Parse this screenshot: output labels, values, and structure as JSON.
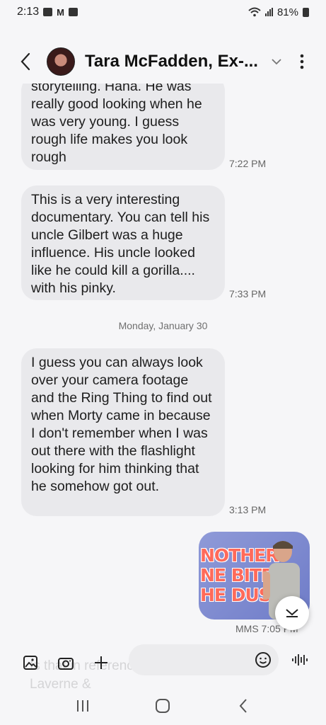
{
  "status_bar": {
    "time": "2:13",
    "battery_percent": "81%"
  },
  "header": {
    "contact_name": "Tara McFadden, Ex-..."
  },
  "messages": [
    {
      "text": "storytelling. Haha. He was really good looking when he was very young. I guess rough life makes you look rough",
      "time": "7:22 PM"
    },
    {
      "text": "This is a very interesting documentary. You can tell his uncle Gilbert was a huge influence. His uncle looked like he could kill a gorilla.... with his pinky.",
      "time": "7:33 PM"
    },
    {
      "text": "I guess you can always look over your camera footage and the Ring Thing to find out when Morty came in because I don't remember when I was out there with the flashlight looking for him thinking that he somehow got out.",
      "time": "3:13 PM"
    }
  ],
  "date_separator": "Monday, January 30",
  "mms": {
    "image_text_line1": "NOTHER",
    "image_text_line2": "NE BITES",
    "image_text_line3": "HE DUST",
    "time": "MMS 7:05 PM"
  },
  "composer": {
    "placeholder": "",
    "ghost_text": "Is that in reference to Shirley from Laverne &"
  },
  "icons": [
    "back-icon",
    "chevron-down-icon",
    "more-vert-icon",
    "gallery-icon",
    "camera-icon",
    "plus-icon",
    "emoji-icon",
    "voice-icon",
    "chevron-down-icon",
    "recents-icon",
    "home-icon",
    "back-nav-icon"
  ]
}
